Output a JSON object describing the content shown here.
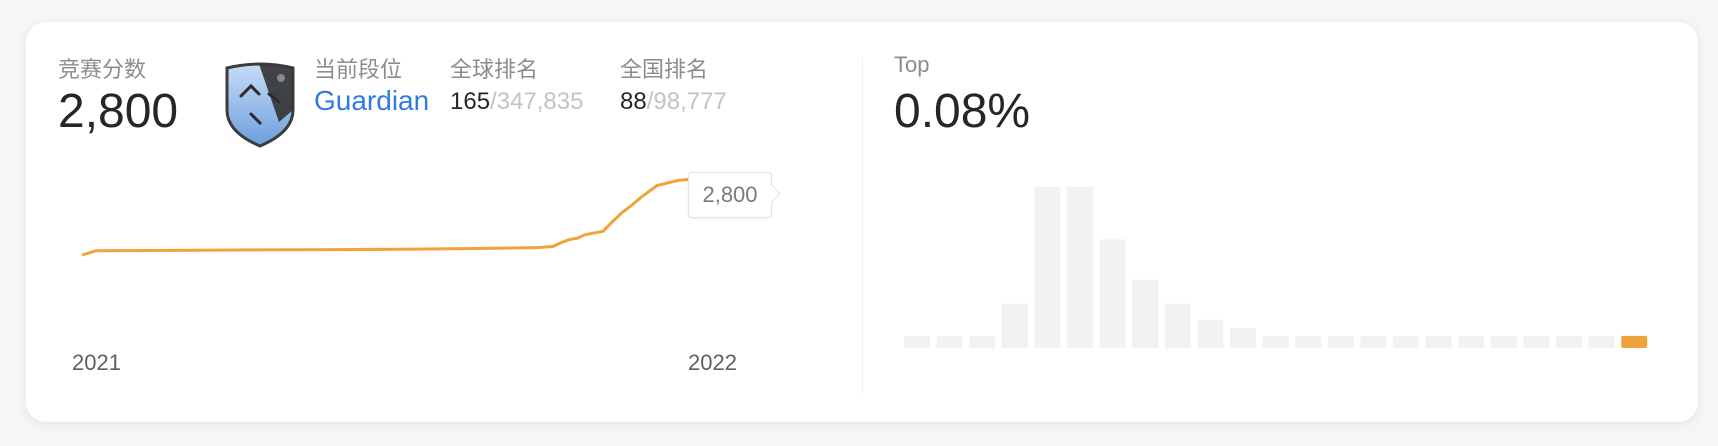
{
  "contest": {
    "score_label": "竞赛分数",
    "score_value": "2,800",
    "level_label": "当前段位",
    "level_value": "Guardian",
    "global_label": "全球排名",
    "global_rank": "165",
    "global_total": "/347,835",
    "national_label": "全国排名",
    "national_rank": "88",
    "national_total": "/98,777"
  },
  "line_chart": {
    "tooltip": "2,800",
    "x_start": "2021",
    "x_end": "2022",
    "color": "#f0a33b"
  },
  "top": {
    "label": "Top",
    "value": "0.08%"
  },
  "chart_data": [
    {
      "type": "line",
      "title": "",
      "xlabel": "",
      "ylabel": "",
      "x_ticks": [
        "2021",
        "2022"
      ],
      "values": [
        2350,
        2375,
        2377,
        2380,
        2382,
        2385,
        2388,
        2390,
        2393,
        2395,
        2398,
        2400,
        2420,
        2440,
        2450,
        2470,
        2490,
        2550,
        2600,
        2640,
        2690,
        2760,
        2790,
        2800,
        2810,
        2800
      ]
    },
    {
      "type": "bar",
      "title": "",
      "values": [
        3,
        3,
        3,
        11,
        40,
        40,
        27,
        17,
        11,
        7,
        5,
        3,
        3,
        3,
        3,
        3,
        3,
        3,
        3,
        3,
        3,
        3,
        3
      ],
      "highlight_index": 22,
      "highlight_color": "#f0a33b",
      "bar_color": "#f1f2f4"
    }
  ]
}
